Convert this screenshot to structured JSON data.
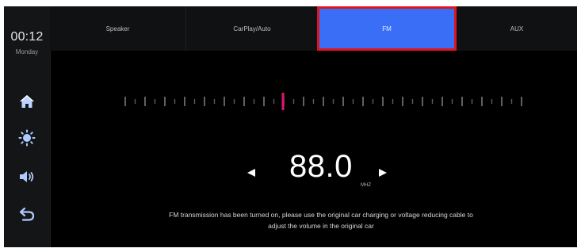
{
  "status": {
    "time": "00:12",
    "day": "Monday"
  },
  "sidebar": {
    "items": [
      {
        "icon": "home-icon"
      },
      {
        "icon": "brightness-icon"
      },
      {
        "icon": "volume-icon"
      },
      {
        "icon": "back-icon"
      }
    ]
  },
  "tabs": [
    {
      "label": "Speaker",
      "active": false
    },
    {
      "label": "CarPlay/Auto",
      "active": false
    },
    {
      "label": "FM",
      "active": true
    },
    {
      "label": "AUX",
      "active": false
    }
  ],
  "tuner": {
    "frequency": "88.0",
    "unit": "MHZ",
    "marker_color": "#e0156f",
    "prev_icon": "arrow-left-icon",
    "next_icon": "arrow-right-icon"
  },
  "message": {
    "line1": "FM transmission has been turned on, please use the original car charging or voltage reducing cable to",
    "line2": "adjust the volume in the original car"
  },
  "colors": {
    "active_tab": "#3a6ef7",
    "highlight_border": "#e0141e",
    "background": "#000000"
  }
}
